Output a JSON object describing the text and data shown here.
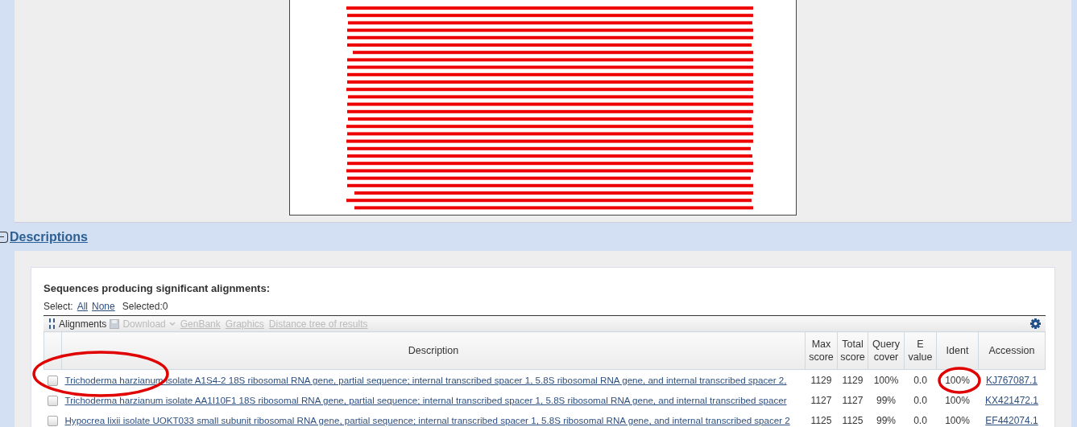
{
  "section": {
    "title": "Descriptions",
    "expanded": true
  },
  "results": {
    "heading": "Sequences producing significant alignments:",
    "select_label": "Select:",
    "select_all": "All",
    "select_none": "None",
    "selected_count": "Selected:0"
  },
  "toolbar": [
    {
      "label": "Alignments",
      "kind": "sort",
      "disabled": false
    },
    {
      "label": "Download",
      "kind": "download",
      "disabled": true
    },
    {
      "label": "GenBank",
      "kind": "link",
      "disabled": true
    },
    {
      "label": "Graphics",
      "kind": "link",
      "disabled": true
    },
    {
      "label": "Distance tree of results",
      "kind": "link",
      "disabled": true
    }
  ],
  "table": {
    "columns": [
      {
        "label": "Description"
      },
      {
        "label": "Max score"
      },
      {
        "label": "Total score"
      },
      {
        "label": "Query cover"
      },
      {
        "label": "E value"
      },
      {
        "label": "Ident"
      },
      {
        "label": "Accession"
      }
    ],
    "rows": [
      {
        "checked": false,
        "description": "Trichoderma harzianum isolate A1S4-2 18S ribosomal RNA gene, partial sequence; internal transcribed spacer 1, 5.8S ribosomal RNA gene, and internal transcribed spacer 2,",
        "max_score": "1129",
        "total_score": "1129",
        "query_cover": "100%",
        "e_value": "0.0",
        "ident": "100%",
        "accession": "KJ767087.1",
        "name_circled": true,
        "ident_circled": true
      },
      {
        "checked": false,
        "description": "Trichoderma harzianum isolate AA1I10F1 18S ribosomal RNA gene, partial sequence; internal transcribed spacer 1, 5.8S ribosomal RNA gene, and internal transcribed spacer",
        "max_score": "1127",
        "total_score": "1127",
        "query_cover": "99%",
        "e_value": "0.0",
        "ident": "100%",
        "accession": "KX421472.1",
        "name_circled": false,
        "ident_circled": false
      },
      {
        "checked": false,
        "description": "Hypocrea lixii isolate UOKT033 small subunit ribosomal RNA gene, partial sequence; internal transcribed spacer 1, 5.8S ribosomal RNA gene, and internal transcribed spacer 2",
        "max_score": "1125",
        "total_score": "1125",
        "query_cover": "99%",
        "e_value": "0.0",
        "ident": "100%",
        "accession": "EF442074.1",
        "name_circled": false,
        "ident_circled": false
      }
    ]
  }
}
